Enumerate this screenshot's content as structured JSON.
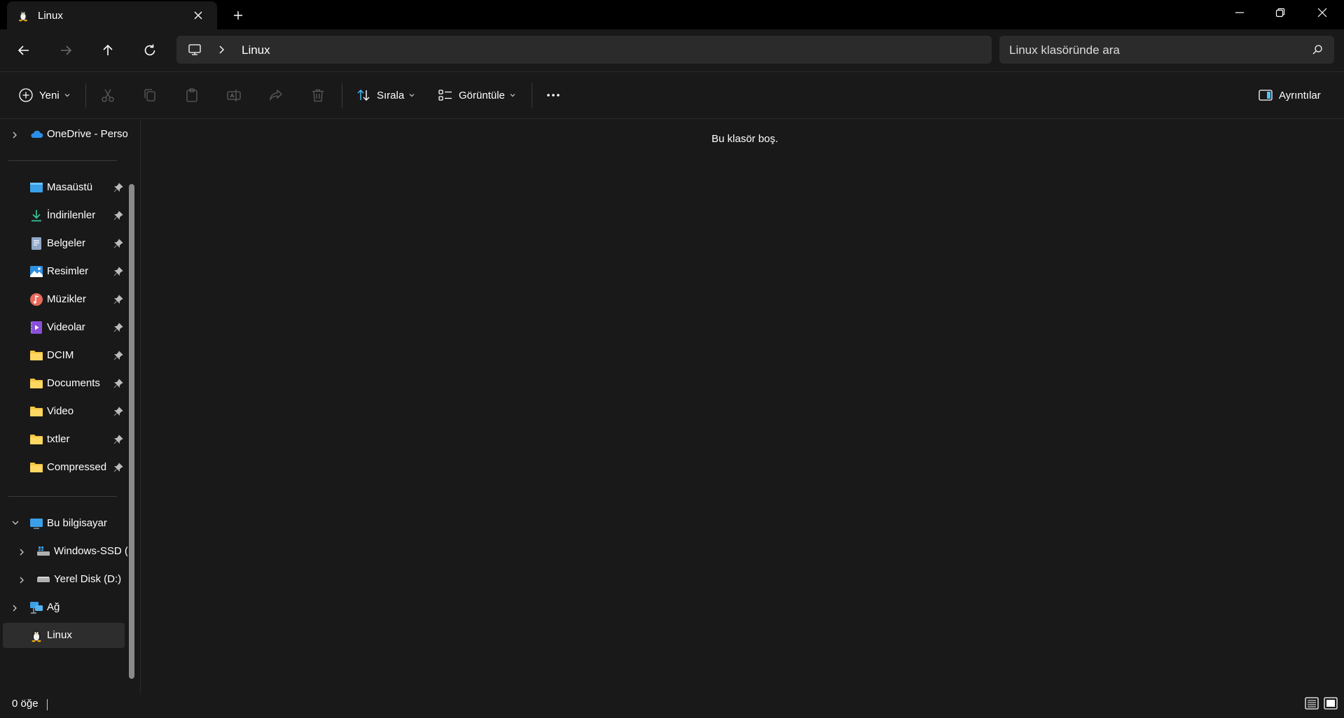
{
  "window": {
    "tab_title": "Linux",
    "tab_icon": "linux-penguin-icon"
  },
  "address": {
    "path_root_icon": "computer-icon",
    "path_segment": "Linux",
    "search_placeholder": "Linux klasöründe ara"
  },
  "toolbar": {
    "new_label": "Yeni",
    "sort_label": "Sırala",
    "view_label": "Görüntüle",
    "details_label": "Ayrıntılar"
  },
  "sidebar": {
    "onedrive": "OneDrive - Perso",
    "quick": [
      {
        "label": "Masaüstü",
        "icon": "desktop-icon"
      },
      {
        "label": "İndirilenler",
        "icon": "download-icon"
      },
      {
        "label": "Belgeler",
        "icon": "documents-icon"
      },
      {
        "label": "Resimler",
        "icon": "pictures-icon"
      },
      {
        "label": "Müzikler",
        "icon": "music-icon"
      },
      {
        "label": "Videolar",
        "icon": "videos-icon"
      },
      {
        "label": "DCIM",
        "icon": "folder-icon"
      },
      {
        "label": "Documents",
        "icon": "folder-icon"
      },
      {
        "label": "Video",
        "icon": "folder-icon"
      },
      {
        "label": "txtler",
        "icon": "folder-icon"
      },
      {
        "label": "Compressed",
        "icon": "folder-icon"
      }
    ],
    "this_pc": "Bu bilgisayar",
    "drive_c": "Windows-SSD (",
    "drive_d": "Yerel Disk (D:)",
    "network": "Ağ",
    "linux": "Linux"
  },
  "content": {
    "empty_message": "Bu klasör boş."
  },
  "status": {
    "item_count": "0 öğe"
  },
  "colors": {
    "background": "#191919",
    "titlebar": "#000000",
    "field": "#2b2b2b",
    "accent_blue": "#4cc2ff",
    "folder_yellow": "#f5c542"
  }
}
